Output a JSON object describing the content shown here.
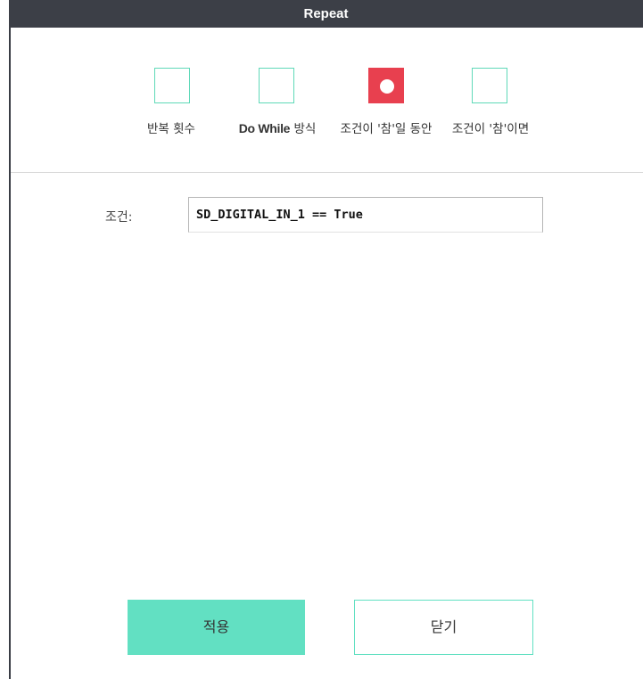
{
  "dialog": {
    "title": "Repeat"
  },
  "options": [
    {
      "label_bold": "",
      "label": "반복 횟수",
      "selected": false
    },
    {
      "label_bold": "Do While",
      "label": " 방식",
      "selected": false
    },
    {
      "label_bold": "",
      "label": "조건이 '참'일 동안",
      "selected": true
    },
    {
      "label_bold": "",
      "label": "조건이 '참'이면",
      "selected": false
    }
  ],
  "condition": {
    "label": "조건:",
    "value": "SD_DIGITAL_IN_1 == True"
  },
  "buttons": {
    "apply": "적용",
    "close": "닫기"
  },
  "colors": {
    "accent": "#62e0c2",
    "selected": "#e8404f",
    "titlebar": "#3c3f47"
  }
}
